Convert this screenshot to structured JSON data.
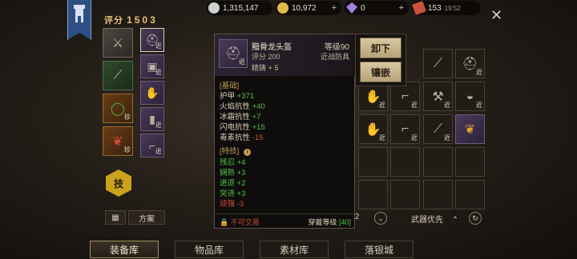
{
  "score": {
    "label": "评分",
    "value": "1503"
  },
  "currencies": [
    {
      "icon": "silver-coin-icon",
      "value": "1,315,147",
      "color": "#cfcfcf"
    },
    {
      "icon": "gold-coin-icon",
      "value": "10,972",
      "color": "#e1b84a"
    },
    {
      "icon": "diamond-icon",
      "value": "0",
      "color": "#a77fe0"
    },
    {
      "icon": "ticket-icon",
      "value": "153",
      "color": "#c9543a"
    }
  ],
  "time": "19:52",
  "equip_slots": [
    {
      "tag": ""
    },
    {
      "tag": "近"
    },
    {
      "tag": ""
    },
    {
      "tag": "近"
    },
    {
      "tag": "珍"
    },
    {
      "tag": "近"
    },
    {
      "tag": "珍"
    },
    {
      "tag": "近"
    },
    {
      "tag": "近"
    }
  ],
  "skill_label": "技",
  "plan_label": "方案",
  "tooltip": {
    "name": "黯骨龙头盔",
    "level": "等级90",
    "score": "评分 200",
    "type": "近战防具",
    "refine_label": "精铸",
    "refine_value": "+ 5",
    "icon_tag": "近",
    "basic_header": "[基础]",
    "basic_stats": [
      {
        "name": "护甲",
        "value": "+371",
        "pos": true
      },
      {
        "name": "火焰抗性",
        "value": "+40",
        "pos": true
      },
      {
        "name": "冰霜抗性",
        "value": "+7",
        "pos": true
      },
      {
        "name": "闪电抗性",
        "value": "+15",
        "pos": true
      },
      {
        "name": "毒素抗性",
        "value": "-15",
        "pos": false
      }
    ],
    "skill_header": "[特技]",
    "skill_stats": [
      {
        "text": "残忍 +4",
        "pos": true
      },
      {
        "text": "娴熟 +3",
        "pos": true
      },
      {
        "text": "进退 +2",
        "pos": true
      },
      {
        "text": "突进 +3",
        "pos": true
      },
      {
        "text": "顽强 -3",
        "pos": false
      }
    ],
    "untradable": "不可交易",
    "req_label": "穿戴等级",
    "req_value": "[40]"
  },
  "actions": {
    "unequip": "卸下",
    "inlay": "镶嵌"
  },
  "bag_tags": [
    "近",
    "近",
    "近",
    "近",
    "近",
    "近",
    "近",
    "近",
    "近",
    ""
  ],
  "pager": "/2",
  "filter": "武器优先",
  "tabs": [
    "装备库",
    "物品库",
    "素材库",
    "落银城"
  ]
}
